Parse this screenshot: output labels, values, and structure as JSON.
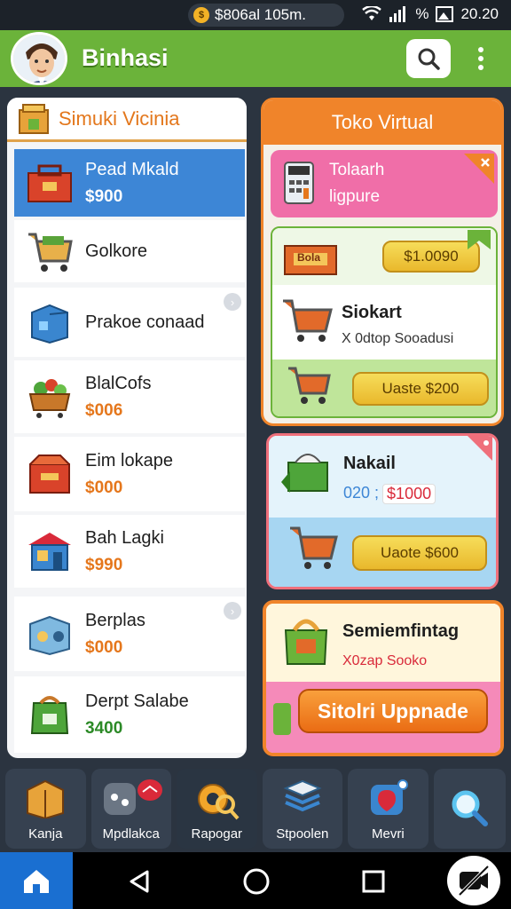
{
  "status": {
    "pill_text": "$806al 105m.",
    "battery_text": "%",
    "time": "20.20"
  },
  "appbar": {
    "title": "Binhasi",
    "search_icon": "search-icon",
    "more_icon": "more-vert-icon"
  },
  "left_panel": {
    "title": "Simuki Vicinia",
    "items": [
      {
        "name": "Pead Mkald",
        "price": "$900"
      },
      {
        "name": "Golkore",
        "price": ""
      },
      {
        "name": "Prakoe conaad",
        "price": ""
      },
      {
        "name": "BlalCofs",
        "price": "$006"
      },
      {
        "name": "Eim lokape",
        "price": "$000"
      },
      {
        "name": "Bah Lagki",
        "price": "$990"
      },
      {
        "name": "Berplas",
        "price": "$000"
      },
      {
        "name": "Derpt Salabe",
        "price": "3400"
      }
    ]
  },
  "right_panel": {
    "title": "Toko Virtual",
    "card1": {
      "line1": "Tolaarh",
      "line2": "ligpure"
    },
    "box_label": "Bola",
    "price_pill": "$1.0090",
    "card2": {
      "title": "Siokart",
      "subtitle": "X 0dtop Sooadusi"
    },
    "btn1": "Uaste $200"
  },
  "card2": {
    "title": "Nakail",
    "price_prefix": "020 ;",
    "price": "$1000",
    "btn": "Uaote $600"
  },
  "card3": {
    "title": "Semiemfintag",
    "subtitle": "X0zap Sooko",
    "btn": "Sitolri Uppnade"
  },
  "bottom_nav": [
    {
      "label": "Kanja"
    },
    {
      "label": "Mpdlakca"
    },
    {
      "label": "Rapogar"
    },
    {
      "label": "Stpoolen"
    },
    {
      "label": "Mevri"
    }
  ],
  "colors": {
    "appbar": "#6bb33a",
    "accent_orange": "#f0842a",
    "selected": "#3d86d6"
  }
}
